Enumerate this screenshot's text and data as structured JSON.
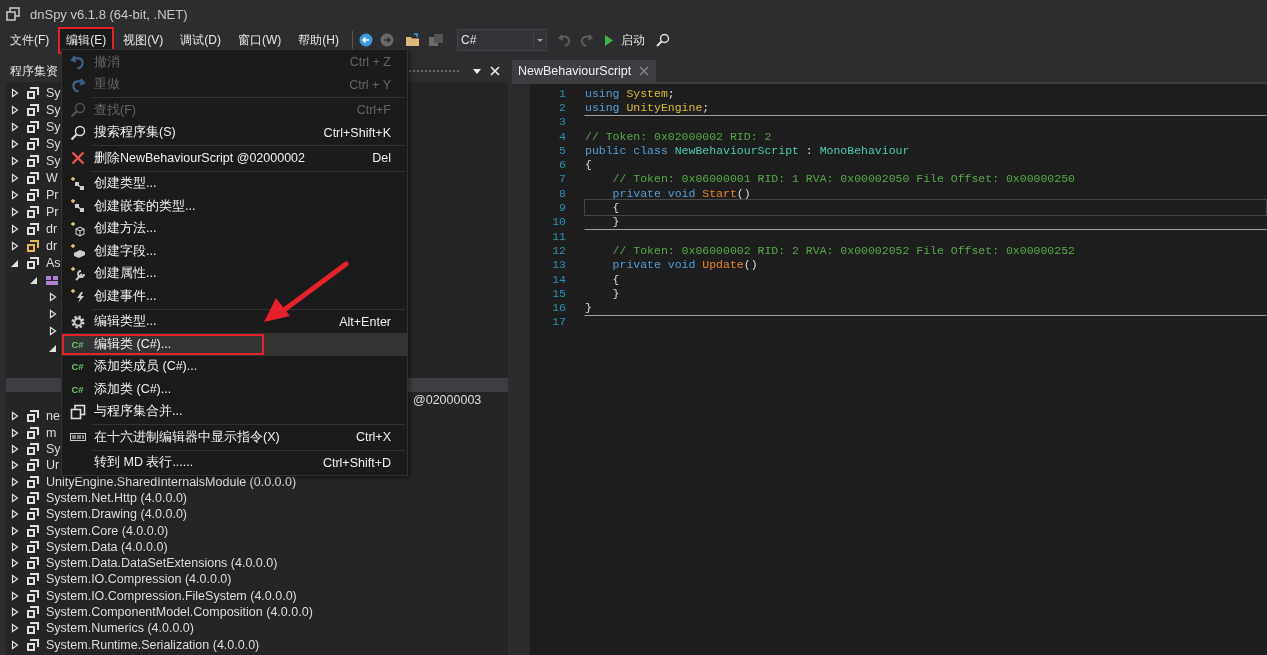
{
  "window": {
    "title": "dnSpy v6.1.8 (64-bit, .NET)"
  },
  "menu_bar": [
    {
      "label": "文件(F)",
      "open": false,
      "annotated": false
    },
    {
      "label": "编辑(E)",
      "open": true,
      "annotated": true
    },
    {
      "label": "视图(V)",
      "open": false,
      "annotated": false
    },
    {
      "label": "调试(D)",
      "open": false,
      "annotated": false
    },
    {
      "label": "窗口(W)",
      "open": false,
      "annotated": false
    },
    {
      "label": "帮助(H)",
      "open": false,
      "annotated": false
    }
  ],
  "toolbar": [
    {
      "kind": "back",
      "disabled": false
    },
    {
      "kind": "forward",
      "disabled": true
    },
    {
      "kind": "open",
      "disabled": false
    },
    {
      "kind": "save",
      "disabled": true
    },
    {
      "kind": "language",
      "value": "C#"
    },
    {
      "kind": "undo",
      "disabled": true
    },
    {
      "kind": "redo",
      "disabled": true
    },
    {
      "kind": "start",
      "label": "启动",
      "disabled": false
    },
    {
      "kind": "search",
      "disabled": false
    }
  ],
  "edit_menu": [
    {
      "kind": "undo",
      "label": "撤消",
      "shortcut": "Ctrl + Z",
      "disabled": true,
      "selected": false,
      "annotated": false
    },
    {
      "kind": "redo",
      "label": "重做",
      "shortcut": "Ctrl + Y",
      "disabled": true,
      "selected": false,
      "annotated": false
    },
    {
      "kind": "separator"
    },
    {
      "kind": "search",
      "label": "查找(F)",
      "shortcut": "Ctrl+F",
      "disabled": true,
      "selected": false,
      "annotated": false
    },
    {
      "kind": "search",
      "label": "搜索程序集(S)",
      "shortcut": "Ctrl+Shift+K",
      "disabled": false,
      "selected": false,
      "annotated": false
    },
    {
      "kind": "separator"
    },
    {
      "kind": "delete",
      "label": "删除NewBehaviourScript @02000002",
      "shortcut": "Del",
      "disabled": false,
      "selected": false,
      "annotated": false
    },
    {
      "kind": "separator"
    },
    {
      "kind": "create-type",
      "label": "创建类型...",
      "disabled": false,
      "selected": false,
      "annotated": false
    },
    {
      "kind": "create-type",
      "label": "创建嵌套的类型...",
      "disabled": false,
      "selected": false,
      "annotated": false
    },
    {
      "kind": "create-method",
      "label": "创建方法...",
      "disabled": false,
      "selected": false,
      "annotated": false
    },
    {
      "kind": "create-field",
      "label": "创建字段...",
      "disabled": false,
      "selected": false,
      "annotated": false
    },
    {
      "kind": "create-property",
      "label": "创建属性...",
      "disabled": false,
      "selected": false,
      "annotated": false
    },
    {
      "kind": "create-event",
      "label": "创建事件...",
      "disabled": false,
      "selected": false,
      "annotated": false
    },
    {
      "kind": "separator"
    },
    {
      "kind": "settings",
      "label": "编辑类型...",
      "shortcut": "Alt+Enter",
      "disabled": false,
      "selected": false,
      "annotated": false
    },
    {
      "kind": "badge",
      "badge": "C#",
      "label": "编辑类 (C#)...",
      "disabled": false,
      "selected": true,
      "annotated": true
    },
    {
      "kind": "badge",
      "badge": "C#",
      "label": "添加类成员 (C#)...",
      "disabled": false,
      "selected": false,
      "annotated": false
    },
    {
      "kind": "badge",
      "badge": "C#",
      "label": "添加类 (C#)...",
      "disabled": false,
      "selected": false,
      "annotated": false
    },
    {
      "kind": "assembly",
      "label": "与程序集合并...",
      "disabled": false,
      "selected": false,
      "annotated": false
    },
    {
      "kind": "separator"
    },
    {
      "kind": "hex",
      "label": "在十六进制编辑器中显示指令(X)",
      "shortcut": "Ctrl+X",
      "disabled": false,
      "selected": false,
      "annotated": false
    },
    {
      "kind": "separator"
    },
    {
      "kind": "plain",
      "label": "转到 MD 表行......",
      "shortcut": "Ctrl+Shift+D",
      "disabled": false,
      "selected": false,
      "annotated": false
    }
  ],
  "tree": {
    "header": "程序集资",
    "nodes": [
      {
        "kind": "assembly",
        "label": "Sy",
        "expanded": false
      },
      {
        "kind": "assembly",
        "label": "Sy",
        "expanded": false
      },
      {
        "kind": "assembly",
        "label": "Sy",
        "expanded": false
      },
      {
        "kind": "assembly",
        "label": "Sy",
        "expanded": false
      },
      {
        "kind": "assembly",
        "label": "Sy",
        "expanded": false
      },
      {
        "kind": "assembly",
        "label": "W",
        "expanded": false
      },
      {
        "kind": "assembly",
        "label": "Pr",
        "expanded": false
      },
      {
        "kind": "assembly",
        "label": "Pr",
        "expanded": false
      },
      {
        "kind": "assembly",
        "label": "dr",
        "expanded": false
      },
      {
        "kind": "assembly",
        "label": "dr",
        "expanded": false,
        "color": "#e8b860"
      },
      {
        "kind": "assembly",
        "label": "As",
        "expanded": true,
        "children": [
          {
            "kind": "namespace",
            "expanded": true,
            "children": [
              {
                "expanded": false
              },
              {
                "expanded": false
              },
              {
                "expanded": false
              },
              {
                "expanded": true
              }
            ]
          }
        ]
      }
    ]
  },
  "lower_tree": {
    "row_tail_text": "@02000003",
    "nodes": [
      {
        "kind": "assembly",
        "label": "ne",
        "expanded": false
      },
      {
        "kind": "assembly",
        "label": "m",
        "expanded": false
      },
      {
        "kind": "assembly",
        "label": "Sy",
        "expanded": false
      },
      {
        "kind": "assembly",
        "label": "Ur",
        "expanded": false
      },
      {
        "kind": "assembly",
        "label": "UnityEngine.SharedInternalsModule (0.0.0.0)",
        "expanded": false
      },
      {
        "kind": "assembly",
        "label": "System.Net.Http (4.0.0.0)",
        "expanded": false
      },
      {
        "kind": "assembly",
        "label": "System.Drawing (4.0.0.0)",
        "expanded": false
      },
      {
        "kind": "assembly",
        "label": "System.Core (4.0.0.0)",
        "expanded": false
      },
      {
        "kind": "assembly",
        "label": "System.Data (4.0.0.0)",
        "expanded": false
      },
      {
        "kind": "assembly",
        "label": "System.Data.DataSetExtensions (4.0.0.0)",
        "expanded": false
      },
      {
        "kind": "assembly",
        "label": "System.IO.Compression (4.0.0.0)",
        "expanded": false
      },
      {
        "kind": "assembly",
        "label": "System.IO.Compression.FileSystem (4.0.0.0)",
        "expanded": false
      },
      {
        "kind": "assembly",
        "label": "System.ComponentModel.Composition (4.0.0.0)",
        "expanded": false
      },
      {
        "kind": "assembly",
        "label": "System.Numerics (4.0.0.0)",
        "expanded": false
      },
      {
        "kind": "assembly",
        "label": "System.Runtime.Serialization (4.0.0.0)",
        "expanded": false
      }
    ]
  },
  "editor": {
    "tab": "NewBehaviourScript",
    "lines": [
      {
        "number": "1",
        "tokens": [
          {
            "kind": "keyword",
            "text": "using"
          },
          {
            "kind": "namespace",
            "text": "System"
          },
          {
            "kind": "plain",
            "text": ";"
          }
        ]
      },
      {
        "number": "2",
        "separator": true,
        "tokens": [
          {
            "kind": "keyword",
            "text": "using"
          },
          {
            "kind": "namespace",
            "text": "UnityEngine"
          },
          {
            "kind": "plain",
            "text": ";"
          }
        ]
      },
      {
        "number": "3"
      },
      {
        "number": "4",
        "tokens": [
          {
            "kind": "comment",
            "text": "// Token: 0x02000002 RID: 2"
          }
        ]
      },
      {
        "number": "5",
        "tokens": [
          {
            "kind": "keyword",
            "text": "public class"
          },
          {
            "kind": "type",
            "text": "NewBehaviourScript"
          },
          {
            "kind": "plain",
            "text": ":"
          },
          {
            "kind": "type",
            "text": "MonoBehaviour"
          }
        ]
      },
      {
        "number": "6",
        "tokens": [
          {
            "kind": "plain",
            "text": "{"
          }
        ]
      },
      {
        "number": "7",
        "nested": true,
        "tokens": [
          {
            "kind": "comment",
            "text": "// Token: 0x06000001 RID: 1 RVA: 0x00002050 File Offset: 0x00000250"
          }
        ]
      },
      {
        "number": "8",
        "nested": true,
        "tokens": [
          {
            "kind": "keyword",
            "text": "private void"
          },
          {
            "kind": "method",
            "text": "Start"
          },
          {
            "kind": "punct",
            "text": "()"
          }
        ]
      },
      {
        "number": "9",
        "nested": true,
        "current": true,
        "tokens": [
          {
            "kind": "plain",
            "text": "{"
          }
        ]
      },
      {
        "number": "10",
        "nested": true,
        "separator": true,
        "tokens": [
          {
            "kind": "plain",
            "text": "}"
          }
        ]
      },
      {
        "number": "11"
      },
      {
        "number": "12",
        "nested": true,
        "tokens": [
          {
            "kind": "comment",
            "text": "// Token: 0x06000002 RID: 2 RVA: 0x00002052 File Offset: 0x00000252"
          }
        ]
      },
      {
        "number": "13",
        "nested": true,
        "tokens": [
          {
            "kind": "keyword",
            "text": "private void"
          },
          {
            "kind": "method",
            "text": "Update"
          },
          {
            "kind": "punct",
            "text": "()"
          }
        ]
      },
      {
        "number": "14",
        "nested": true,
        "tokens": [
          {
            "kind": "plain",
            "text": "{"
          }
        ]
      },
      {
        "number": "15",
        "nested": true,
        "tokens": [
          {
            "kind": "plain",
            "text": "}"
          }
        ]
      },
      {
        "number": "16",
        "separator": true,
        "tokens": [
          {
            "kind": "plain",
            "text": "}"
          }
        ]
      },
      {
        "number": "17"
      }
    ]
  }
}
